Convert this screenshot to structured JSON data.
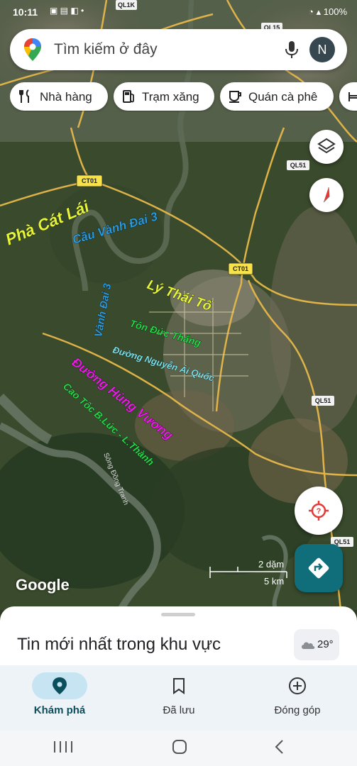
{
  "status_bar": {
    "time": "10:11",
    "battery": "100%"
  },
  "search": {
    "placeholder": "Tìm kiếm ở đây",
    "avatar_letter": "N"
  },
  "chips": [
    {
      "label": "Nhà hàng",
      "icon": "fork-knife-icon"
    },
    {
      "label": "Trạm xăng",
      "icon": "gas-pump-icon"
    },
    {
      "label": "Quán cà phê",
      "icon": "coffee-cup-icon"
    }
  ],
  "road_markers": [
    "QL1K",
    "QL15",
    "QL51",
    "CT01",
    "CT01",
    "QL51",
    "QL51"
  ],
  "annotations": {
    "pha_cat_lai": "Phà Cát Lái",
    "cau_vanh_dai_3": "Cầu Vành Đai 3",
    "ly_thai_to": "Lý Thái Tổ",
    "vanh_dai_3": "Vành Đai 3",
    "ton_duc_thang": "Tôn Đức Thắng",
    "duong_nguyen_ai_quoc": "Đường Nguyễn Ái Quốc",
    "duong_hung_vuong": "Đường Hùng Vương",
    "cao_toc": "Cao Tốc B.Lức - L.Thành"
  },
  "map_labels": {
    "song": "Sông Đồng Tranh"
  },
  "scale": {
    "miles": "2 dặm",
    "km": "5 km"
  },
  "google_logo": "Google",
  "colors": {
    "accent": "#0f6e7a",
    "yellow_label": "#e6f53a",
    "blue_label": "#2b9be0",
    "green_label": "#27d84a",
    "magenta_label": "#e51fe0"
  },
  "sheet": {
    "title": "Tin mới nhất trong khu vực",
    "temperature": "29°"
  },
  "bottom_nav": [
    {
      "label": "Khám phá",
      "icon": "location-pin-icon",
      "active": true
    },
    {
      "label": "Đã lưu",
      "icon": "bookmark-icon",
      "active": false
    },
    {
      "label": "Đóng góp",
      "icon": "add-circle-icon",
      "active": false
    }
  ]
}
